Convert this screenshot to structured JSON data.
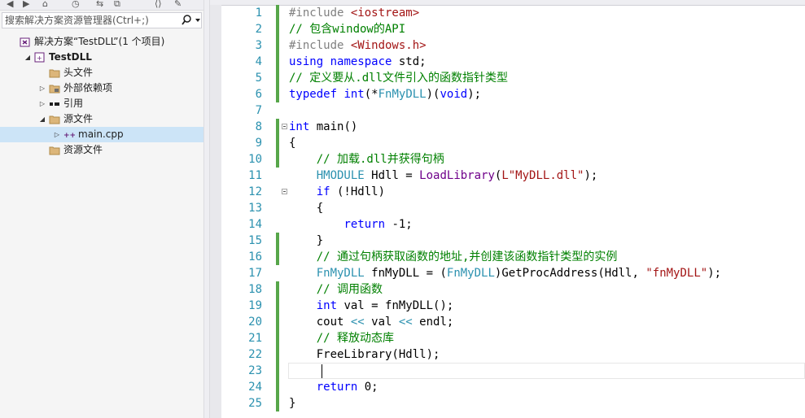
{
  "toolbar": {
    "glyphs": [
      "◀",
      "▶",
      "⌂",
      "◷",
      "⇆",
      "⧉",
      "⟨⟩",
      "✎"
    ]
  },
  "search": {
    "placeholder": "搜索解决方案资源管理器(Ctrl+;)",
    "button_icon": "search-icon"
  },
  "tree": [
    {
      "label": "解决方案“TestDLL”(1 个项目)",
      "icon": "solution-icon",
      "expander": "",
      "indent": 0
    },
    {
      "label": "TestDLL",
      "icon": "project-icon",
      "expander": "◢",
      "indent": 1,
      "bold": true
    },
    {
      "label": "头文件",
      "icon": "folder-icon",
      "expander": "",
      "indent": 2
    },
    {
      "label": "外部依赖项",
      "icon": "external-deps-icon",
      "expander": "▷",
      "indent": 2
    },
    {
      "label": "引用",
      "icon": "references-icon",
      "expander": "▷",
      "indent": 2
    },
    {
      "label": "源文件",
      "icon": "folder-icon",
      "expander": "◢",
      "indent": 2
    },
    {
      "label": "main.cpp",
      "icon": "cpp-file-icon",
      "expander": "▷",
      "indent": 3,
      "selected": true
    },
    {
      "label": "资源文件",
      "icon": "folder-icon",
      "expander": "",
      "indent": 2
    }
  ],
  "editor": {
    "current_line": 23,
    "lines": [
      {
        "n": "1",
        "tokens": [
          [
            "pp",
            "#include "
          ],
          [
            "str",
            "<iostream>"
          ]
        ]
      },
      {
        "n": "2",
        "tokens": [
          [
            "cm",
            "// 包含window的API"
          ]
        ]
      },
      {
        "n": "3",
        "tokens": [
          [
            "pp",
            "#include "
          ],
          [
            "str",
            "<Windows.h>"
          ]
        ]
      },
      {
        "n": "4",
        "tokens": [
          [
            "kw",
            "using"
          ],
          [
            "",
            " "
          ],
          [
            "kw",
            "namespace"
          ],
          [
            "",
            " std;"
          ]
        ]
      },
      {
        "n": "5",
        "tokens": [
          [
            "cm",
            "// 定义要从.dll文件引入的函数指针类型"
          ]
        ]
      },
      {
        "n": "6",
        "tokens": [
          [
            "kw",
            "typedef"
          ],
          [
            "",
            " "
          ],
          [
            "kw",
            "int"
          ],
          [
            "",
            "(*"
          ],
          [
            "ty",
            "FnMyDLL"
          ],
          [
            "",
            ")("
          ],
          [
            "kw",
            "void"
          ],
          [
            "",
            ");"
          ]
        ]
      },
      {
        "n": "7",
        "tokens": []
      },
      {
        "n": "8",
        "tokens": [
          [
            "kw",
            "int"
          ],
          [
            "",
            " main()"
          ]
        ]
      },
      {
        "n": "9",
        "tokens": [
          [
            "",
            "{"
          ]
        ]
      },
      {
        "n": "10",
        "tokens": [
          [
            "",
            "    "
          ],
          [
            "cm",
            "// 加载.dll并获得句柄"
          ]
        ]
      },
      {
        "n": "11",
        "tokens": [
          [
            "",
            "    "
          ],
          [
            "ty",
            "HMODULE"
          ],
          [
            "",
            " Hdll = "
          ],
          [
            "mac",
            "LoadLibrary"
          ],
          [
            "",
            "("
          ],
          [
            "str",
            "L\"MyDLL.dll\""
          ],
          [
            "",
            ");"
          ]
        ]
      },
      {
        "n": "12",
        "tokens": [
          [
            "",
            "    "
          ],
          [
            "kw",
            "if"
          ],
          [
            "",
            " (!Hdll)"
          ]
        ]
      },
      {
        "n": "13",
        "tokens": [
          [
            "",
            "    {"
          ]
        ]
      },
      {
        "n": "14",
        "tokens": [
          [
            "",
            "        "
          ],
          [
            "kw",
            "return"
          ],
          [
            "",
            " -1;"
          ]
        ]
      },
      {
        "n": "15",
        "tokens": [
          [
            "",
            "    }"
          ]
        ]
      },
      {
        "n": "16",
        "tokens": [
          [
            "",
            "    "
          ],
          [
            "cm",
            "// 通过句柄获取函数的地址,并创建该函数指针类型的实例"
          ]
        ]
      },
      {
        "n": "17",
        "tokens": [
          [
            "",
            "    "
          ],
          [
            "ty",
            "FnMyDLL"
          ],
          [
            "",
            " fnMyDLL = ("
          ],
          [
            "ty",
            "FnMyDLL"
          ],
          [
            "",
            ")GetProcAddress(Hdll, "
          ],
          [
            "str",
            "\"fnMyDLL\""
          ],
          [
            "",
            ");"
          ]
        ]
      },
      {
        "n": "18",
        "tokens": [
          [
            "",
            "    "
          ],
          [
            "cm",
            "// 调用函数"
          ]
        ]
      },
      {
        "n": "19",
        "tokens": [
          [
            "",
            "    "
          ],
          [
            "kw",
            "int"
          ],
          [
            "",
            " val = fnMyDLL();"
          ]
        ]
      },
      {
        "n": "20",
        "tokens": [
          [
            "",
            "    cout "
          ],
          [
            "ty",
            "<<"
          ],
          [
            "",
            " val "
          ],
          [
            "ty",
            "<<"
          ],
          [
            "",
            " endl;"
          ]
        ]
      },
      {
        "n": "21",
        "tokens": [
          [
            "",
            "    "
          ],
          [
            "cm",
            "// 释放动态库"
          ]
        ]
      },
      {
        "n": "22",
        "tokens": [
          [
            "",
            "    FreeLibrary(Hdll);"
          ]
        ]
      },
      {
        "n": "23",
        "tokens": [
          [
            "",
            "    "
          ]
        ]
      },
      {
        "n": "24",
        "tokens": [
          [
            "",
            "    "
          ],
          [
            "kw",
            "return"
          ],
          [
            "",
            " 0;"
          ]
        ]
      },
      {
        "n": "25",
        "tokens": [
          [
            "",
            "}"
          ]
        ]
      }
    ],
    "changed_lines": [
      1,
      2,
      3,
      4,
      5,
      6,
      8,
      9,
      10,
      15,
      16,
      18,
      19,
      20,
      21,
      22,
      23,
      24,
      25
    ],
    "fold_lines": [
      8,
      12
    ]
  }
}
